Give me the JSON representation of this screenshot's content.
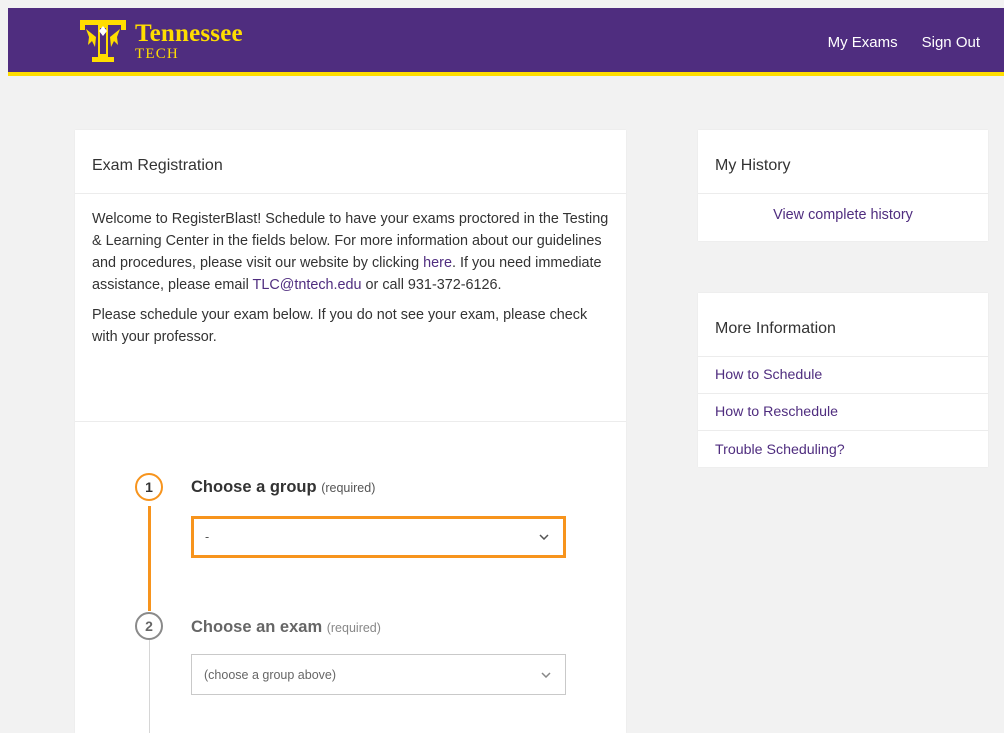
{
  "header": {
    "logo_name": "Tennessee",
    "logo_sub": "TECH",
    "nav": [
      {
        "label": "My Exams"
      },
      {
        "label": "Sign Out"
      }
    ]
  },
  "main": {
    "title": "Exam Registration",
    "intro_1": "Welcome to RegisterBlast! Schedule to have your exams proctored in the Testing & Learning Center in the fields below. For more information about our guidelines and procedures, please visit our website by clicking ",
    "intro_here_link": "here",
    "intro_2": ". If you need immediate assistance, please email ",
    "intro_email_link": "TLC@tntech.edu",
    "intro_3": " or call 931-372-6126.",
    "intro_para2": "Please schedule your exam below. If you do not see your exam, please check with your professor.",
    "steps": [
      {
        "number": "1",
        "title": "Choose a group",
        "required": "(required)",
        "select_value": "-"
      },
      {
        "number": "2",
        "title": "Choose an exam",
        "required": "(required)",
        "select_value": "(choose a group above)"
      }
    ]
  },
  "history": {
    "title": "My History",
    "link": "View complete history"
  },
  "more_info": {
    "title": "More Information",
    "links": [
      {
        "label": "How to Schedule"
      },
      {
        "label": "How to Reschedule"
      },
      {
        "label": "Trouble Scheduling?"
      }
    ]
  },
  "colors": {
    "brand_purple": "#4f2d7f",
    "brand_gold": "#ffdd00",
    "active_orange": "#f7941d"
  },
  "icons": [
    "tennessee-tech-logo-icon",
    "chevron-down-icon"
  ]
}
